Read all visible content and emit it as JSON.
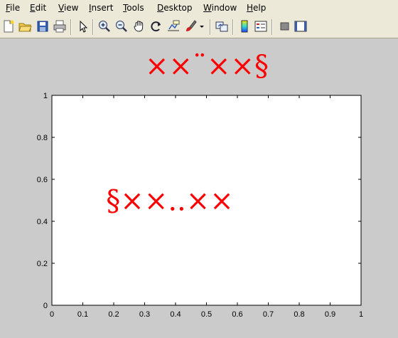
{
  "menubar": {
    "items": [
      {
        "label": "File"
      },
      {
        "label": "Edit"
      },
      {
        "label": "View"
      },
      {
        "label": "Insert"
      },
      {
        "label": "Tools"
      },
      {
        "label": "Desktop"
      },
      {
        "label": "Window"
      },
      {
        "label": "Help"
      }
    ]
  },
  "toolbar": {
    "buttons": [
      {
        "icon": "new-figure-icon"
      },
      {
        "icon": "open-file-icon"
      },
      {
        "icon": "save-icon"
      },
      {
        "icon": "print-icon"
      },
      {
        "icon": "edit-plot-arrow-icon"
      },
      {
        "icon": "zoom-in-icon"
      },
      {
        "icon": "zoom-out-icon"
      },
      {
        "icon": "pan-hand-icon"
      },
      {
        "icon": "rotate-3d-icon"
      },
      {
        "icon": "data-cursor-icon"
      },
      {
        "icon": "brush-icon"
      },
      {
        "icon": "brush-dropdown-icon"
      },
      {
        "icon": "link-plot-icon"
      },
      {
        "icon": "colorbar-icon"
      },
      {
        "icon": "legend-icon"
      },
      {
        "icon": "hide-plot-tools-icon"
      },
      {
        "icon": "show-plot-tools-icon"
      }
    ]
  },
  "colors": {
    "text_red": "#ff0000",
    "axes_bg": "#ffffff",
    "figure_bg": "#cbcbcb",
    "chrome_bg": "#ece9d8"
  },
  "chart_data": {
    "type": "scatter",
    "title": "××¨××§",
    "annotation": {
      "text": "§××..××",
      "x": 0.18,
      "y": 0.5
    },
    "xlim": [
      0,
      1
    ],
    "ylim": [
      0,
      1
    ],
    "xticks": [
      "0",
      "0.1",
      "0.2",
      "0.3",
      "0.4",
      "0.5",
      "0.6",
      "0.7",
      "0.8",
      "0.9",
      "1"
    ],
    "yticks": [
      "0",
      "0.2",
      "0.4",
      "0.6",
      "0.8",
      "1"
    ],
    "grid": false,
    "series": []
  }
}
